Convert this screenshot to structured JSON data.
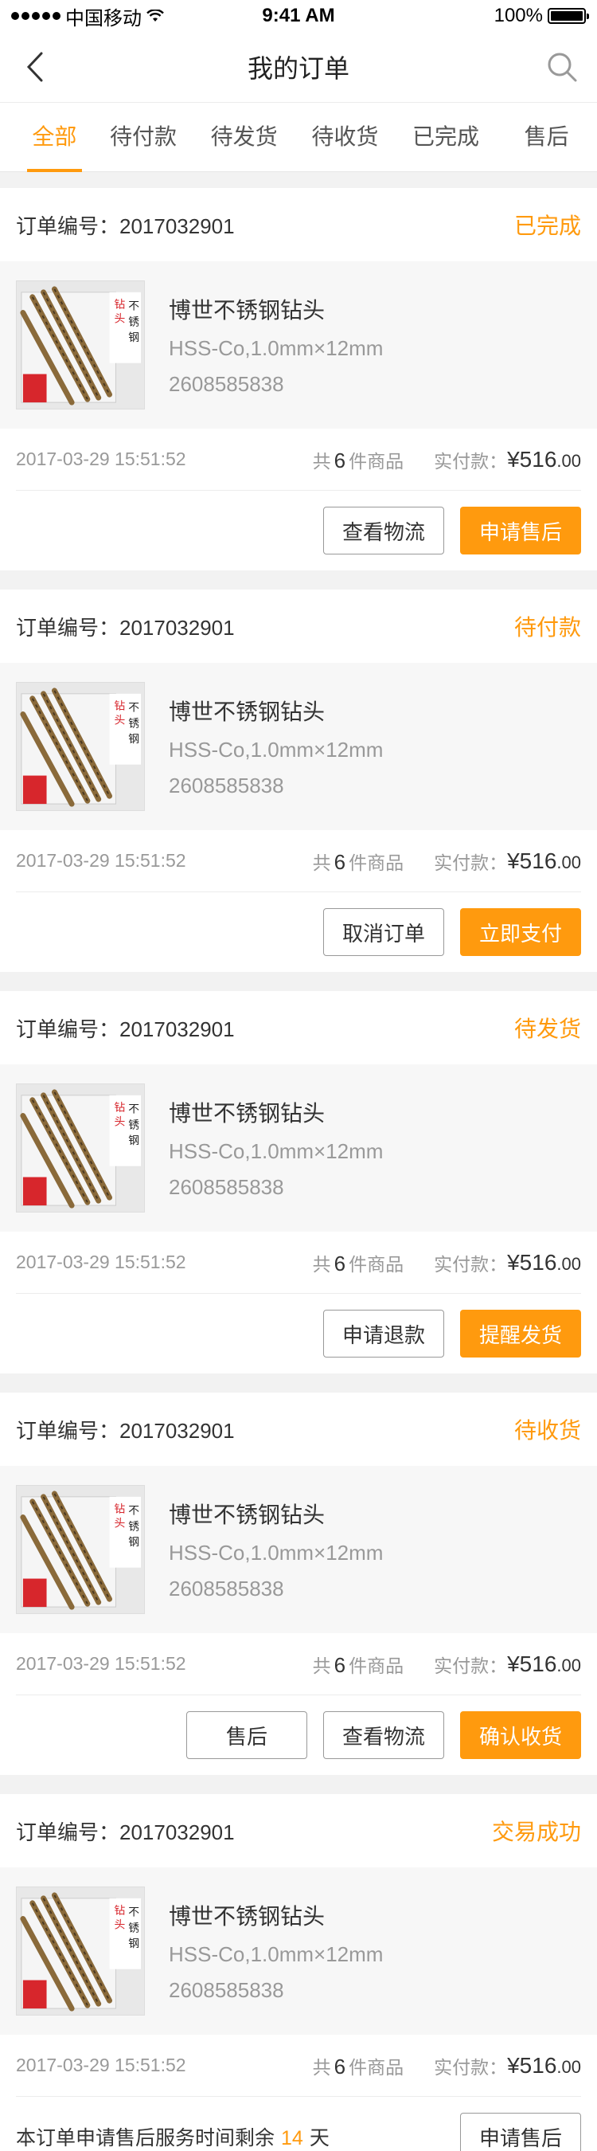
{
  "status_bar": {
    "carrier": "中国移动",
    "time": "9:41 AM",
    "battery": "100%"
  },
  "nav": {
    "title": "我的订单",
    "back_icon": "chevron-left-icon",
    "search_icon": "search-icon"
  },
  "tabs": [
    "全部",
    "待付款",
    "待发货",
    "待收货",
    "已完成",
    "售后"
  ],
  "active_tab": 0,
  "colors": {
    "accent": "#ff9a0e",
    "background": "#f2f2f2"
  },
  "orders": [
    {
      "order_label": "订单编号：2017032901",
      "status": "已完成",
      "product": {
        "name": "博世不锈钢钻头",
        "spec": "HSS-Co,1.0mm×12mm",
        "sku": "2608585838"
      },
      "time": "2017-03-29 15:51:52",
      "count_prefix": "共",
      "count": "6",
      "count_suffix": "件商品",
      "pay_label": "实付款：",
      "price_main": "¥516",
      "price_decimal": ".00",
      "actions": [
        "查看物流",
        "申请售后"
      ]
    },
    {
      "order_label": "订单编号：2017032901",
      "status": "待付款",
      "product": {
        "name": "博世不锈钢钻头",
        "spec": "HSS-Co,1.0mm×12mm",
        "sku": "2608585838"
      },
      "time": "2017-03-29 15:51:52",
      "count_prefix": "共",
      "count": "6",
      "count_suffix": "件商品",
      "pay_label": "实付款：",
      "price_main": "¥516",
      "price_decimal": ".00",
      "actions": [
        "取消订单",
        "立即支付"
      ]
    },
    {
      "order_label": "订单编号：2017032901",
      "status": "待发货",
      "product": {
        "name": "博世不锈钢钻头",
        "spec": "HSS-Co,1.0mm×12mm",
        "sku": "2608585838"
      },
      "time": "2017-03-29 15:51:52",
      "count_prefix": "共",
      "count": "6",
      "count_suffix": "件商品",
      "pay_label": "实付款：",
      "price_main": "¥516",
      "price_decimal": ".00",
      "actions": [
        "申请退款",
        "提醒发货"
      ]
    },
    {
      "order_label": "订单编号：2017032901",
      "status": "待收货",
      "product": {
        "name": "博世不锈钢钻头",
        "spec": "HSS-Co,1.0mm×12mm",
        "sku": "2608585838"
      },
      "time": "2017-03-29 15:51:52",
      "count_prefix": "共",
      "count": "6",
      "count_suffix": "件商品",
      "pay_label": "实付款：",
      "price_main": "¥516",
      "price_decimal": ".00",
      "actions": [
        "售后",
        "查看物流",
        "确认收货"
      ]
    },
    {
      "order_label": "订单编号：2017032901",
      "status": "交易成功",
      "product": {
        "name": "博世不锈钢钻头",
        "spec": "HSS-Co,1.0mm×12mm",
        "sku": "2608585838"
      },
      "time": "2017-03-29 15:51:52",
      "count_prefix": "共",
      "count": "6",
      "count_suffix": "件商品",
      "pay_label": "实付款：",
      "price_main": "¥516",
      "price_decimal": ".00",
      "notice_prefix": "本订单申请售后服务时间剩余",
      "notice_days": "14",
      "notice_suffix": "天",
      "actions": [
        "申请售后"
      ]
    }
  ]
}
